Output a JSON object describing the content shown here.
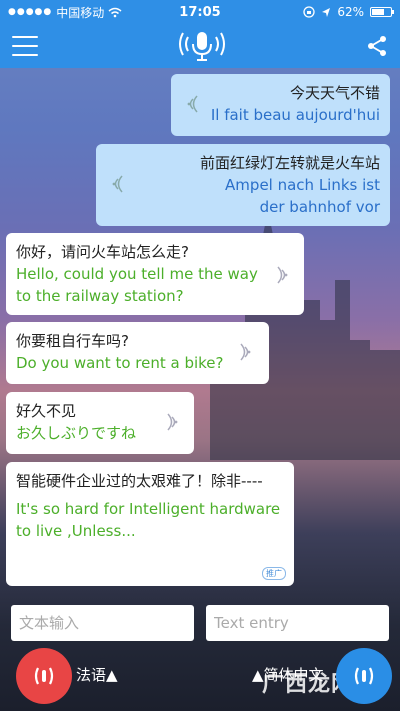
{
  "status": {
    "carrier": "中国移动",
    "time": "17:05",
    "battery": "62%"
  },
  "messages": [
    {
      "side": "right",
      "source": "今天天气不错",
      "translation": "Il fait beau aujourd'hui"
    },
    {
      "side": "right",
      "source": "前面红绿灯左转就是火车站",
      "translation": "Ampel nach Links ist der bahnhof vor"
    },
    {
      "side": "left",
      "source": "你好，请问火车站怎么走?",
      "translation": "Hello, could you tell me the way to the railway station?"
    },
    {
      "side": "left",
      "source": "你要租自行车吗?",
      "translation": "Do you want to rent a bike?"
    },
    {
      "side": "left",
      "source": "好久不见",
      "translation": "お久しぶりですね"
    },
    {
      "side": "left",
      "source": "智能硬件企业过的太艰难了！除非----",
      "translation": "It's so hard for Intelligent hardware to live  ,Unless...",
      "badge": "推广"
    }
  ],
  "inputs": {
    "left_placeholder": "文本输入",
    "right_placeholder": "Text entry"
  },
  "controls": {
    "left_lang": "法语▲",
    "right_lang": "▲简体中文"
  },
  "watermark": "广西龙网",
  "icons": {
    "menu": "hamburger-icon",
    "mic": "microphone-icon",
    "share": "share-icon",
    "speaker": "speaker-icon"
  },
  "colors": {
    "header": "#2f8fe6",
    "right_bubble": "#bfe0fb",
    "left_bubble": "#ffffff",
    "right_translation": "#2a6fc9",
    "left_translation": "#4caf2a",
    "record_left": "#e84545",
    "record_right": "#2a8ee6"
  }
}
